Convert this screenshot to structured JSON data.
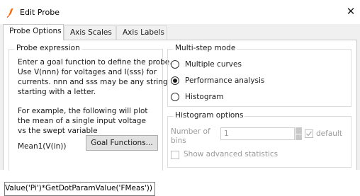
{
  "window": {
    "title": "Edit Probe",
    "close_symbol": "✕"
  },
  "tabs": [
    {
      "label": "Probe Options"
    },
    {
      "label": "Axis Scales"
    },
    {
      "label": "Axis Labels"
    }
  ],
  "probe_expression": {
    "legend": "Probe expression",
    "help_lines": [
      "Enter a goal function to define the probe.",
      "Use V(nnn) for voltages and I(sss) for",
      "currents. nnn and sss may be any string",
      "starting with a letter."
    ],
    "example_lines": [
      "For example, the following will plot",
      "the mean of a single input voltage",
      "vs the swept variable"
    ],
    "example_expression": "Mean1(V(in))",
    "goal_functions_button": "Goal Functions...",
    "expression_value": "amValue('Pi')*GetDotParamValue('FMeas'))"
  },
  "multistep": {
    "legend": "Multi-step mode",
    "options": [
      {
        "label": "Multiple curves",
        "selected": false
      },
      {
        "label": "Performance analysis",
        "selected": true
      },
      {
        "label": "Histogram",
        "selected": false
      }
    ]
  },
  "histogram": {
    "legend": "Histogram options",
    "bins_label_line1": "Number of",
    "bins_label_line2": "bins",
    "bins_value": "1",
    "default_label": "default",
    "default_checked": true,
    "advanced_label": "Show advanced statistics",
    "advanced_checked": false
  },
  "colors": {
    "accent_icon": "#ff6a00"
  }
}
